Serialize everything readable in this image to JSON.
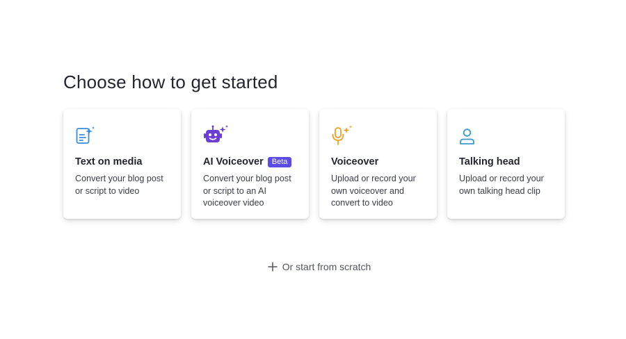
{
  "heading": "Choose how to get started",
  "cards": [
    {
      "title": "Text on media",
      "badge": "",
      "description": "Convert your blog post or script to video",
      "icon": "document-sparkle-icon",
      "icon_color": "#3b8bd6"
    },
    {
      "title": "AI Voiceover",
      "badge": "Beta",
      "description": "Convert your blog post or script to an AI voiceover video",
      "icon": "robot-sparkle-icon",
      "icon_color": "#6a3fd6"
    },
    {
      "title": "Voiceover",
      "badge": "",
      "description": "Upload or record your own voiceover and convert to video",
      "icon": "microphone-sparkle-icon",
      "icon_color": "#f0a020"
    },
    {
      "title": "Talking head",
      "badge": "",
      "description": "Upload or record your own talking head clip",
      "icon": "person-icon",
      "icon_color": "#3a9ac8"
    }
  ],
  "scratch": {
    "label": "Or start from scratch",
    "icon": "plus-icon"
  },
  "colors": {
    "badge_bg": "#5b4ce8",
    "heading": "#23262e",
    "text": "#3a3d45"
  }
}
